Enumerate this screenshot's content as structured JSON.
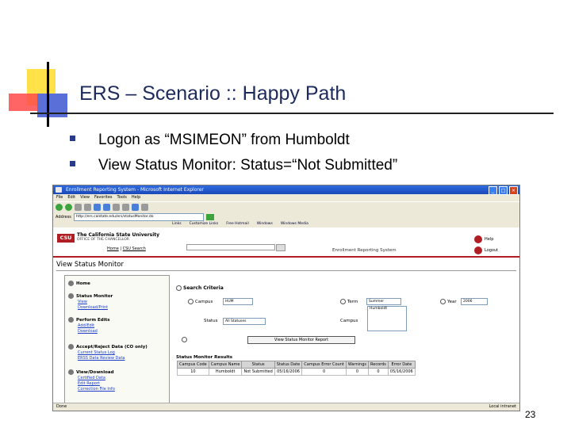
{
  "slide": {
    "title": "ERS – Scenario :: Happy Path",
    "bullets": [
      "Logon as “MSIMEON” from Humboldt",
      "View Status Monitor: Status=“Not Submitted”"
    ],
    "page_number": "23"
  },
  "browser": {
    "window_title": "Enrollment Reporting System - Microsoft Internet Explorer",
    "menu": [
      "File",
      "Edit",
      "View",
      "Favorites",
      "Tools",
      "Help"
    ],
    "address_label": "Address",
    "address_value": "http://ers.calstate.edu/ers/statusMonitor.do",
    "links": [
      "Links",
      "Customize Links",
      "Free Hotmail",
      "Windows",
      "Windows Media"
    ]
  },
  "app": {
    "logo": "CSU",
    "university": "The California State University",
    "university_sub": "OFFICE OF THE CHANCELLOR",
    "nav_home": "Home",
    "nav_search": "CSU Search",
    "system_name": "Enrollment Reporting System",
    "help": "Help",
    "logout": "Logout",
    "page_heading": "View Status Monitor"
  },
  "sidebar": {
    "home": "Home",
    "sections": [
      {
        "label": "Status Monitor",
        "links": [
          "View",
          "Download/Print"
        ]
      },
      {
        "label": "Perform Edits",
        "links": [
          "Add/Edit",
          "Download"
        ]
      },
      {
        "label": "Accept/Reject Data (CO only)",
        "links": [
          "Current Status Log",
          "ERSS Data Review Data"
        ]
      },
      {
        "label": "View/Download",
        "links": [
          "Certified Data",
          "Edit Report",
          "Correction File Info"
        ]
      }
    ]
  },
  "search": {
    "title": "Search Criteria",
    "campus_label": "Campus",
    "campus_value": "HUM",
    "term_label": "Term",
    "term_value": "Summer",
    "year_label": "Year",
    "year_value": "2006",
    "status_label": "Status",
    "status_value": "All Statuses",
    "campus_list_label": "Campus",
    "campus_list_option": "Humboldt",
    "button": "View Status Monitor Report"
  },
  "results": {
    "title": "Status Monitor Results",
    "headers": [
      "Campus Code",
      "Campus Name",
      "Status",
      "Status Date",
      "Campus Error Count",
      "Warnings",
      "Records",
      "Error Date"
    ],
    "rows": [
      [
        "10",
        "Humboldt",
        "Not Submitted",
        "05/16/2006",
        "0",
        "0",
        "0",
        "05/16/2006"
      ]
    ]
  },
  "statusbar": {
    "left": "Done",
    "right": "Local intranet"
  }
}
